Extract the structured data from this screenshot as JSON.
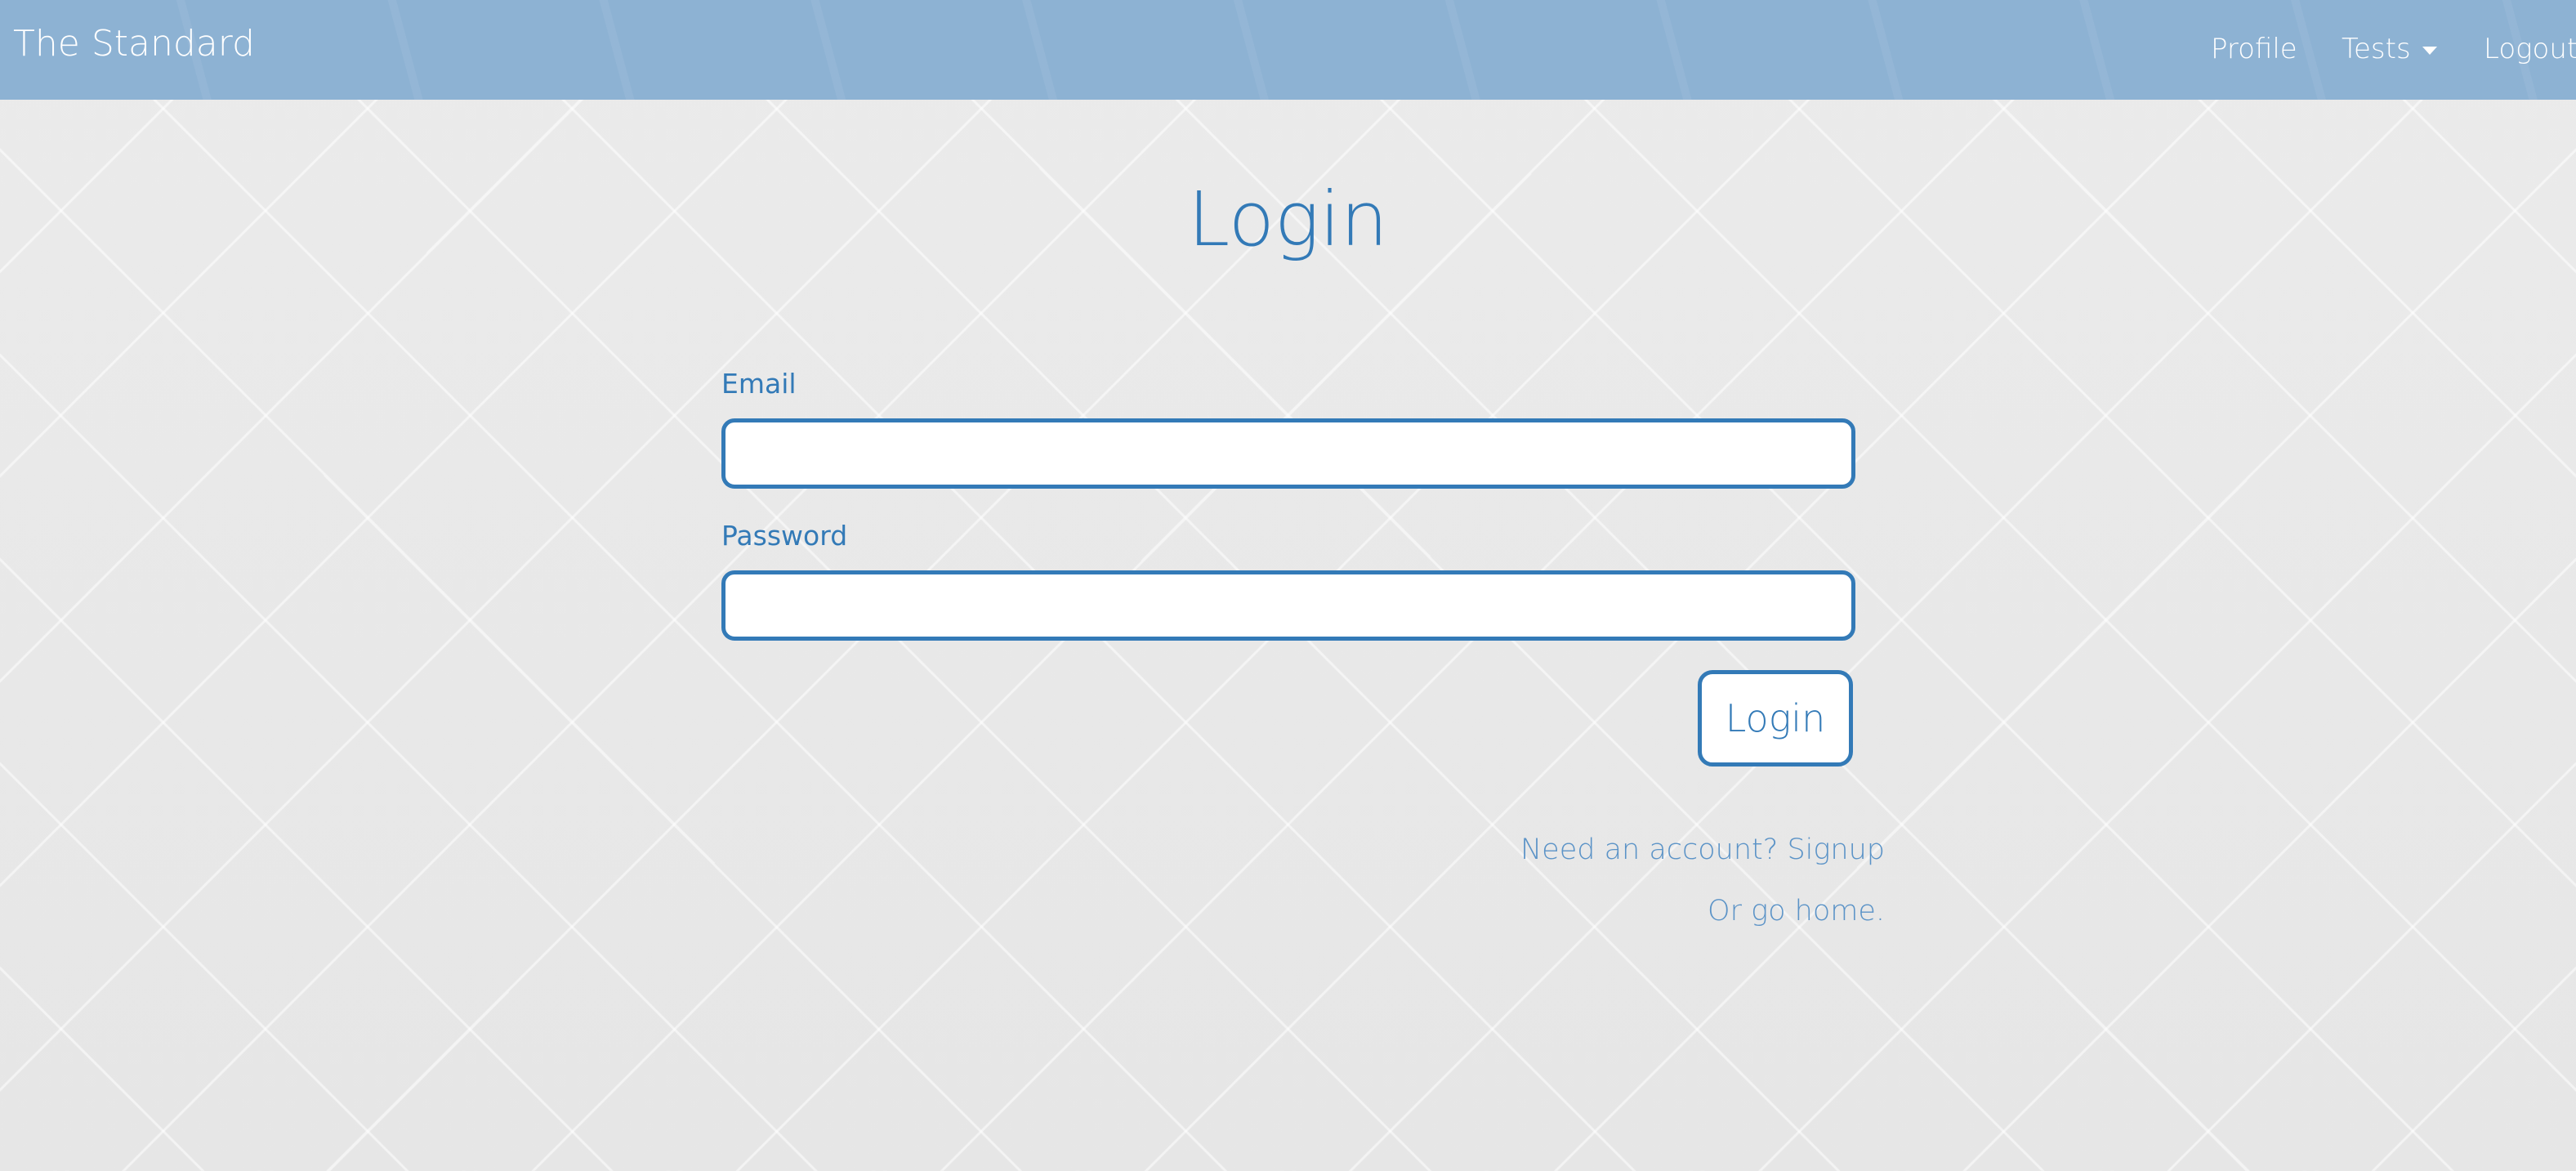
{
  "navbar": {
    "brand": "The Standard",
    "items": [
      {
        "label": "Profile"
      },
      {
        "label": "Tests",
        "has_dropdown": true
      },
      {
        "label": "Logout"
      }
    ]
  },
  "page": {
    "title": "Login",
    "email_label": "Email",
    "email_value": "",
    "password_label": "Password",
    "password_value": "",
    "login_button": "Login",
    "signup_link": "Need an account? Signup",
    "home_link": "Or go home."
  },
  "colors": {
    "accent": "#337ab7",
    "navbar": "#8db2d3",
    "background": "#e8e8e8"
  }
}
